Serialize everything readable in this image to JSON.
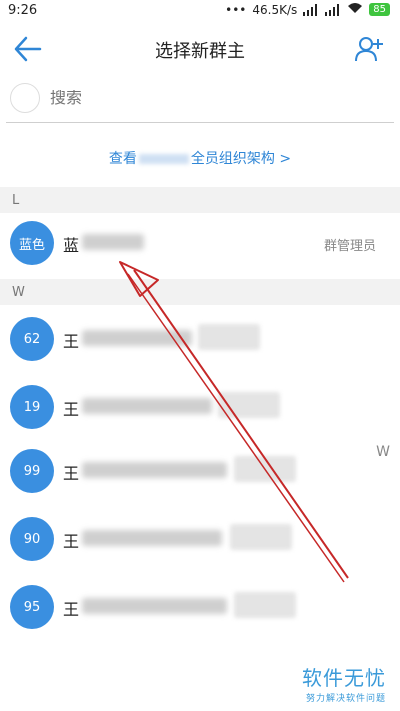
{
  "status_bar": {
    "time": "9:26",
    "net_speed": "46.5K/s",
    "battery": "85"
  },
  "header": {
    "title": "选择新群主",
    "back_icon": "back-arrow-icon",
    "add_icon": "add-user-icon"
  },
  "search": {
    "placeholder": "搜索"
  },
  "org_link": {
    "prefix": "查看",
    "suffix": "全员组织架构 >"
  },
  "sections": [
    {
      "letter": "L"
    },
    {
      "letter": "W"
    }
  ],
  "members": [
    {
      "avatar": "蓝色",
      "name": "蓝",
      "role": "群管理员"
    },
    {
      "avatar": "62",
      "name": "王"
    },
    {
      "avatar": "19",
      "name": "王"
    },
    {
      "avatar": "99",
      "name": "王"
    },
    {
      "avatar": "90",
      "name": "王"
    },
    {
      "avatar": "95",
      "name": "王"
    }
  ],
  "index_letter": "W",
  "watermark": {
    "title": "软件无忧",
    "subtitle": "努力解决软件问题"
  },
  "colors": {
    "accent": "#2f86d6",
    "avatar": "#3a8fe0",
    "annotation": "#c62828"
  }
}
